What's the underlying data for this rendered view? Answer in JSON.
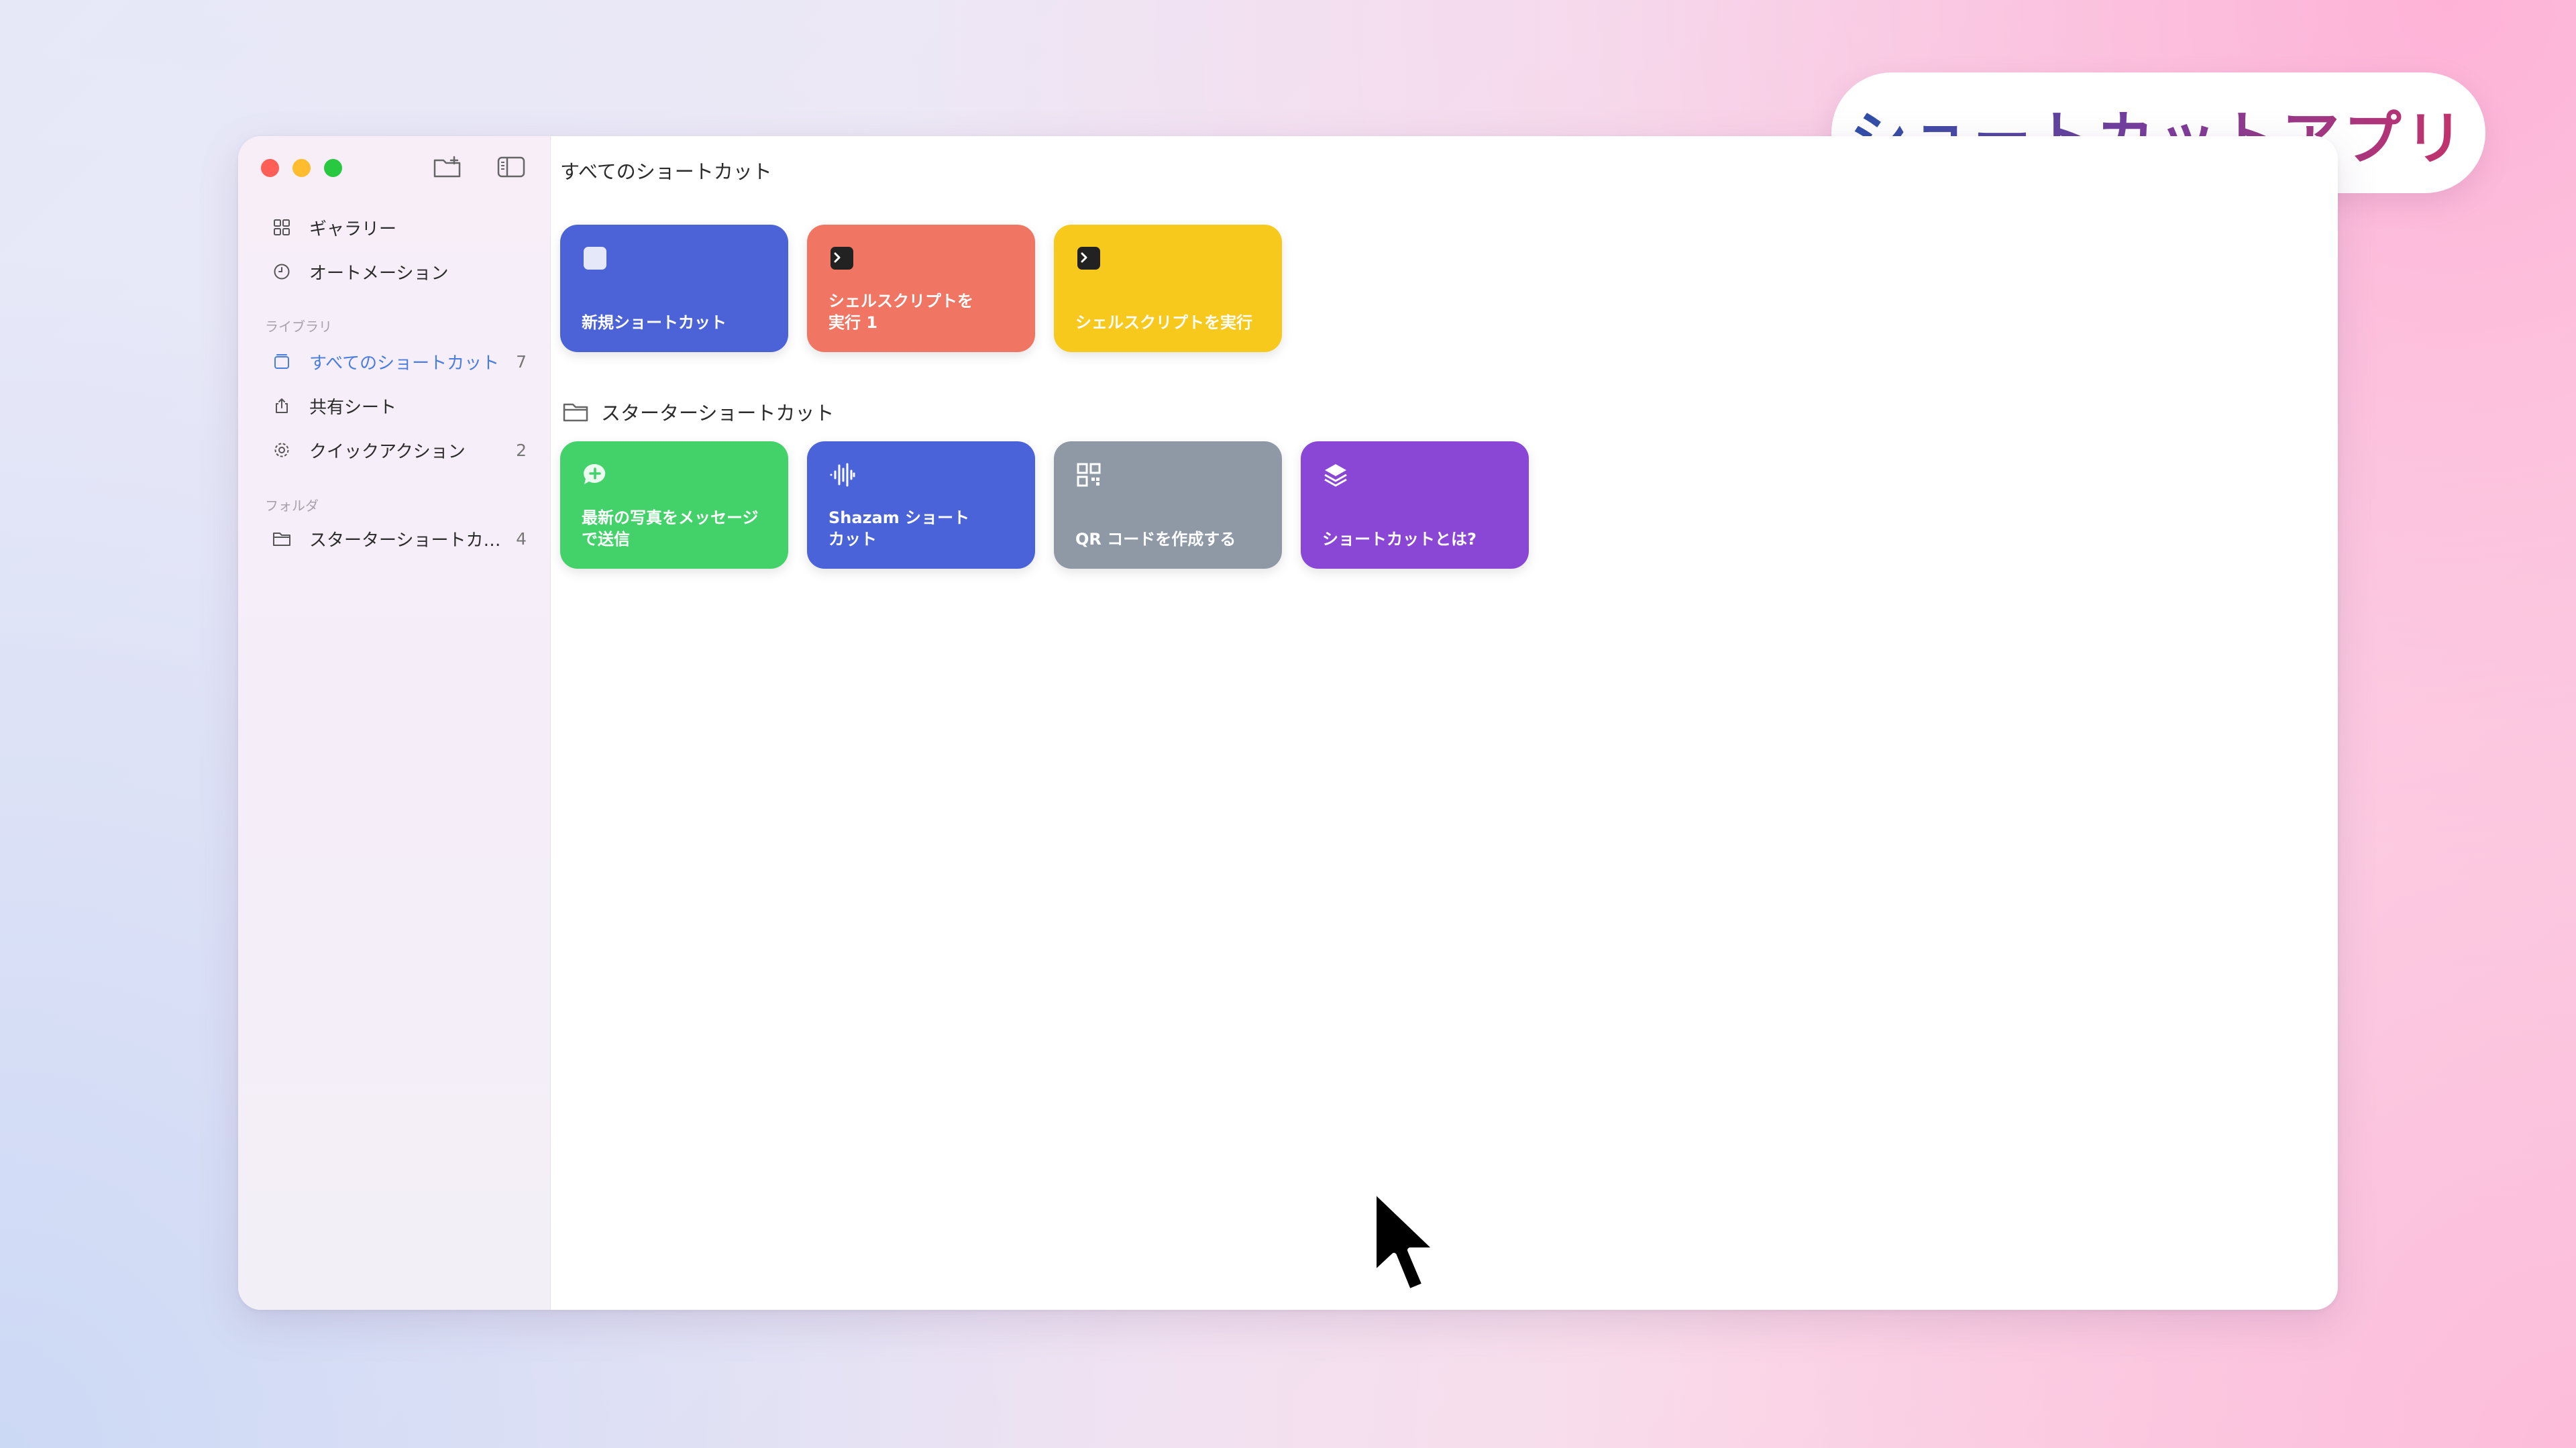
{
  "badge": {
    "text": "ショートカットアプリ"
  },
  "window": {
    "traffic_colors": [
      "#ff5f57",
      "#febc2e",
      "#28c840"
    ],
    "title": "すべてのショートカット"
  },
  "sidebar": {
    "top_items": [
      {
        "label": "ギャラリー",
        "icon": "grid-icon"
      },
      {
        "label": "オートメーション",
        "icon": "clock-icon"
      }
    ],
    "library_header": "ライブラリ",
    "library_items": [
      {
        "label": "すべてのショートカット",
        "count": "7",
        "icon": "square-stack-icon",
        "active": true
      },
      {
        "label": "共有シート",
        "count": "",
        "icon": "share-icon"
      },
      {
        "label": "クイックアクション",
        "count": "2",
        "icon": "gear-icon"
      }
    ],
    "folder_header": "フォルダ",
    "folder_items": [
      {
        "label": "スターターショートカ…",
        "count": "4",
        "icon": "folder-icon"
      }
    ]
  },
  "shortcuts": [
    {
      "label": "新規ショートカット",
      "color": "#4c63d8",
      "icon": "square-icon"
    },
    {
      "label": "シェルスクリプトを\n実行 1",
      "color": "#f07563",
      "icon": "terminal-icon"
    },
    {
      "label": "シェルスクリプトを実行",
      "color": "#f7c91d",
      "icon": "terminal-icon"
    }
  ],
  "starter_folder": {
    "title": "スターターショートカット",
    "items": [
      {
        "label": "最新の写真をメッセージ\nで送信",
        "color": "#43d26a",
        "icon": "message-plus-icon"
      },
      {
        "label": "Shazam ショート\nカット",
        "color": "#4a63d9",
        "icon": "waveform-icon"
      },
      {
        "label": "QR コードを作成する",
        "color": "#8f99a6",
        "icon": "qr-code-icon"
      },
      {
        "label": "ショートカットとは?",
        "color": "#8a47d6",
        "icon": "layers-icon"
      }
    ]
  }
}
